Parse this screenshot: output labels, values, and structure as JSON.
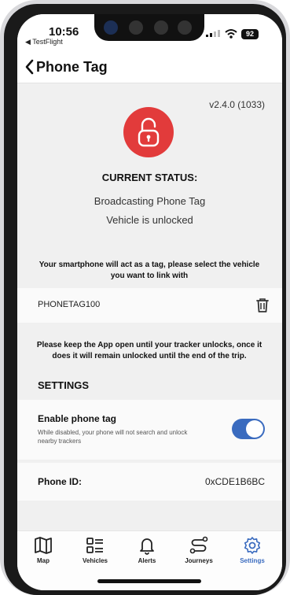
{
  "status_bar": {
    "time": "10:56",
    "back_app": "◀ TestFlight",
    "battery": "92"
  },
  "nav": {
    "title": "Phone Tag"
  },
  "version": "v2.4.0 (1033)",
  "current_status": {
    "title": "CURRENT STATUS:",
    "line1": "Broadcasting Phone Tag",
    "line2": "Vehicle is unlocked"
  },
  "instruction": "Your smartphone will act as a tag, please select the vehicle you want to link with",
  "tag": {
    "name": "PHONETAG100"
  },
  "keep_open_note": "Please keep the App open until your tracker unlocks, once it does it will remain unlocked until the end of the trip.",
  "settings": {
    "heading": "SETTINGS",
    "enable_title": "Enable phone tag",
    "enable_desc": "While disabled, your phone will not search and unlock nearby trackers",
    "enabled": true,
    "phone_id_label": "Phone ID:",
    "phone_id_value": "0xCDE1B6BC"
  },
  "tabs": [
    {
      "label": "Map",
      "icon": "map-icon"
    },
    {
      "label": "Vehicles",
      "icon": "vehicles-icon"
    },
    {
      "label": "Alerts",
      "icon": "bell-icon"
    },
    {
      "label": "Journeys",
      "icon": "route-icon"
    },
    {
      "label": "Settings",
      "icon": "gear-icon",
      "active": true
    }
  ],
  "colors": {
    "accent": "#3a6bbf",
    "lock_red": "#e23b3b"
  }
}
